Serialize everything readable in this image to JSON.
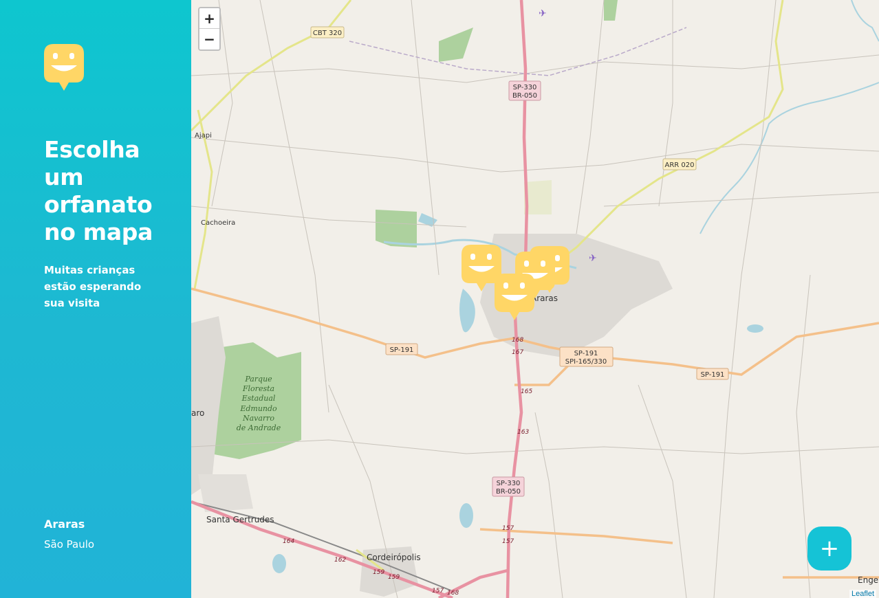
{
  "sidebar": {
    "logo_icon": "happy-face-icon",
    "title": "Escolha um orfanato no mapa",
    "subtitle": "Muitas crianças estão esperando sua visita",
    "location": {
      "city": "Araras",
      "state": "São Paulo"
    }
  },
  "map": {
    "zoom_in_label": "+",
    "zoom_out_label": "−",
    "add_button_label": "+",
    "attribution": "Leaflet",
    "place_labels": {
      "ajapi": "Ajapi",
      "cachoeira": "Cachoeira",
      "araras": "Araras",
      "rio_claro": "aro",
      "santa_gertrudes": "Santa Gertrudes",
      "cordeiropolis": "Cordeirópolis",
      "engenheiro": "Enge"
    },
    "park_label": [
      "Parque",
      "Floresta",
      "Estadual",
      "Edmundo",
      "Navarro",
      "de Andrade"
    ],
    "road_shields": {
      "cbt320": "CBT 320",
      "sp330_north": [
        "SP-330",
        "BR-050"
      ],
      "arr020": "ARR 020",
      "sp191_west": "SP-191",
      "sp191_center": [
        "SP-191",
        "SPI-165/330"
      ],
      "sp191_east": "SP-191",
      "sp330_south": [
        "SP-330",
        "BR-050"
      ]
    },
    "km_markers": [
      "168",
      "167",
      "165",
      "163",
      "157",
      "157",
      "164",
      "162",
      "159",
      "159",
      "157",
      "168"
    ],
    "marker_count": 4
  },
  "colors": {
    "sidebar_top": "#0ec6cf",
    "sidebar_bottom": "#21b3d7",
    "marker_yellow": "#ffd666",
    "fab": "#15c3d6"
  }
}
